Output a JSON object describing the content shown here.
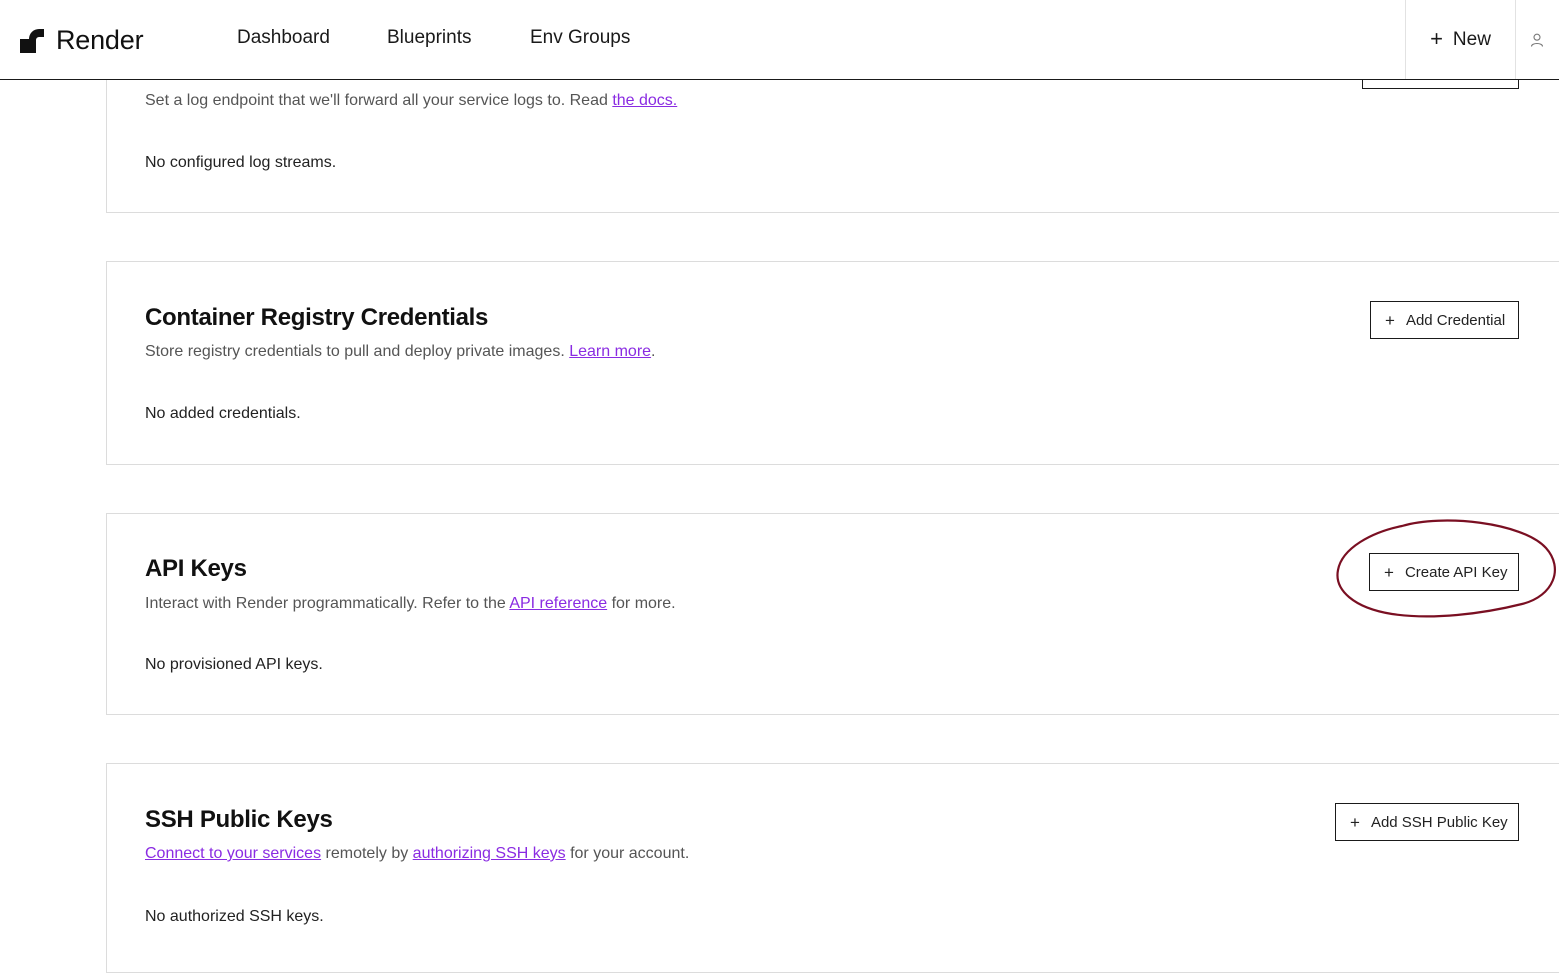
{
  "header": {
    "brand": "Render",
    "nav": [
      "Dashboard",
      "Blueprints",
      "Env Groups"
    ],
    "new_label": "New",
    "new_icon": "plus-icon",
    "user_icon": "user-icon"
  },
  "log_streams": {
    "desc_prefix": "Set a log endpoint that we'll forward all your service logs to. Read ",
    "desc_link": "the docs.",
    "empty": "No configured log streams."
  },
  "registry": {
    "title": "Container Registry Credentials",
    "desc_prefix": "Store registry credentials to pull and deploy private images. ",
    "desc_link": "Learn more",
    "desc_suffix": ".",
    "button": "Add Credential",
    "empty": "No added credentials."
  },
  "api_keys": {
    "title": "API Keys",
    "desc_prefix": "Interact with Render programmatically. Refer to the ",
    "desc_link": "API reference",
    "desc_suffix": " for more.",
    "button": "Create API Key",
    "empty": "No provisioned API keys."
  },
  "ssh_keys": {
    "title": "SSH Public Keys",
    "desc_link1": "Connect to your services",
    "desc_mid": " remotely by ",
    "desc_link2": "authorizing SSH keys",
    "desc_suffix": " for your account.",
    "button": "Add SSH Public Key",
    "empty": "No authorized SSH keys."
  },
  "colors": {
    "link": "#8a2be2",
    "annotation": "#7a0f22"
  }
}
